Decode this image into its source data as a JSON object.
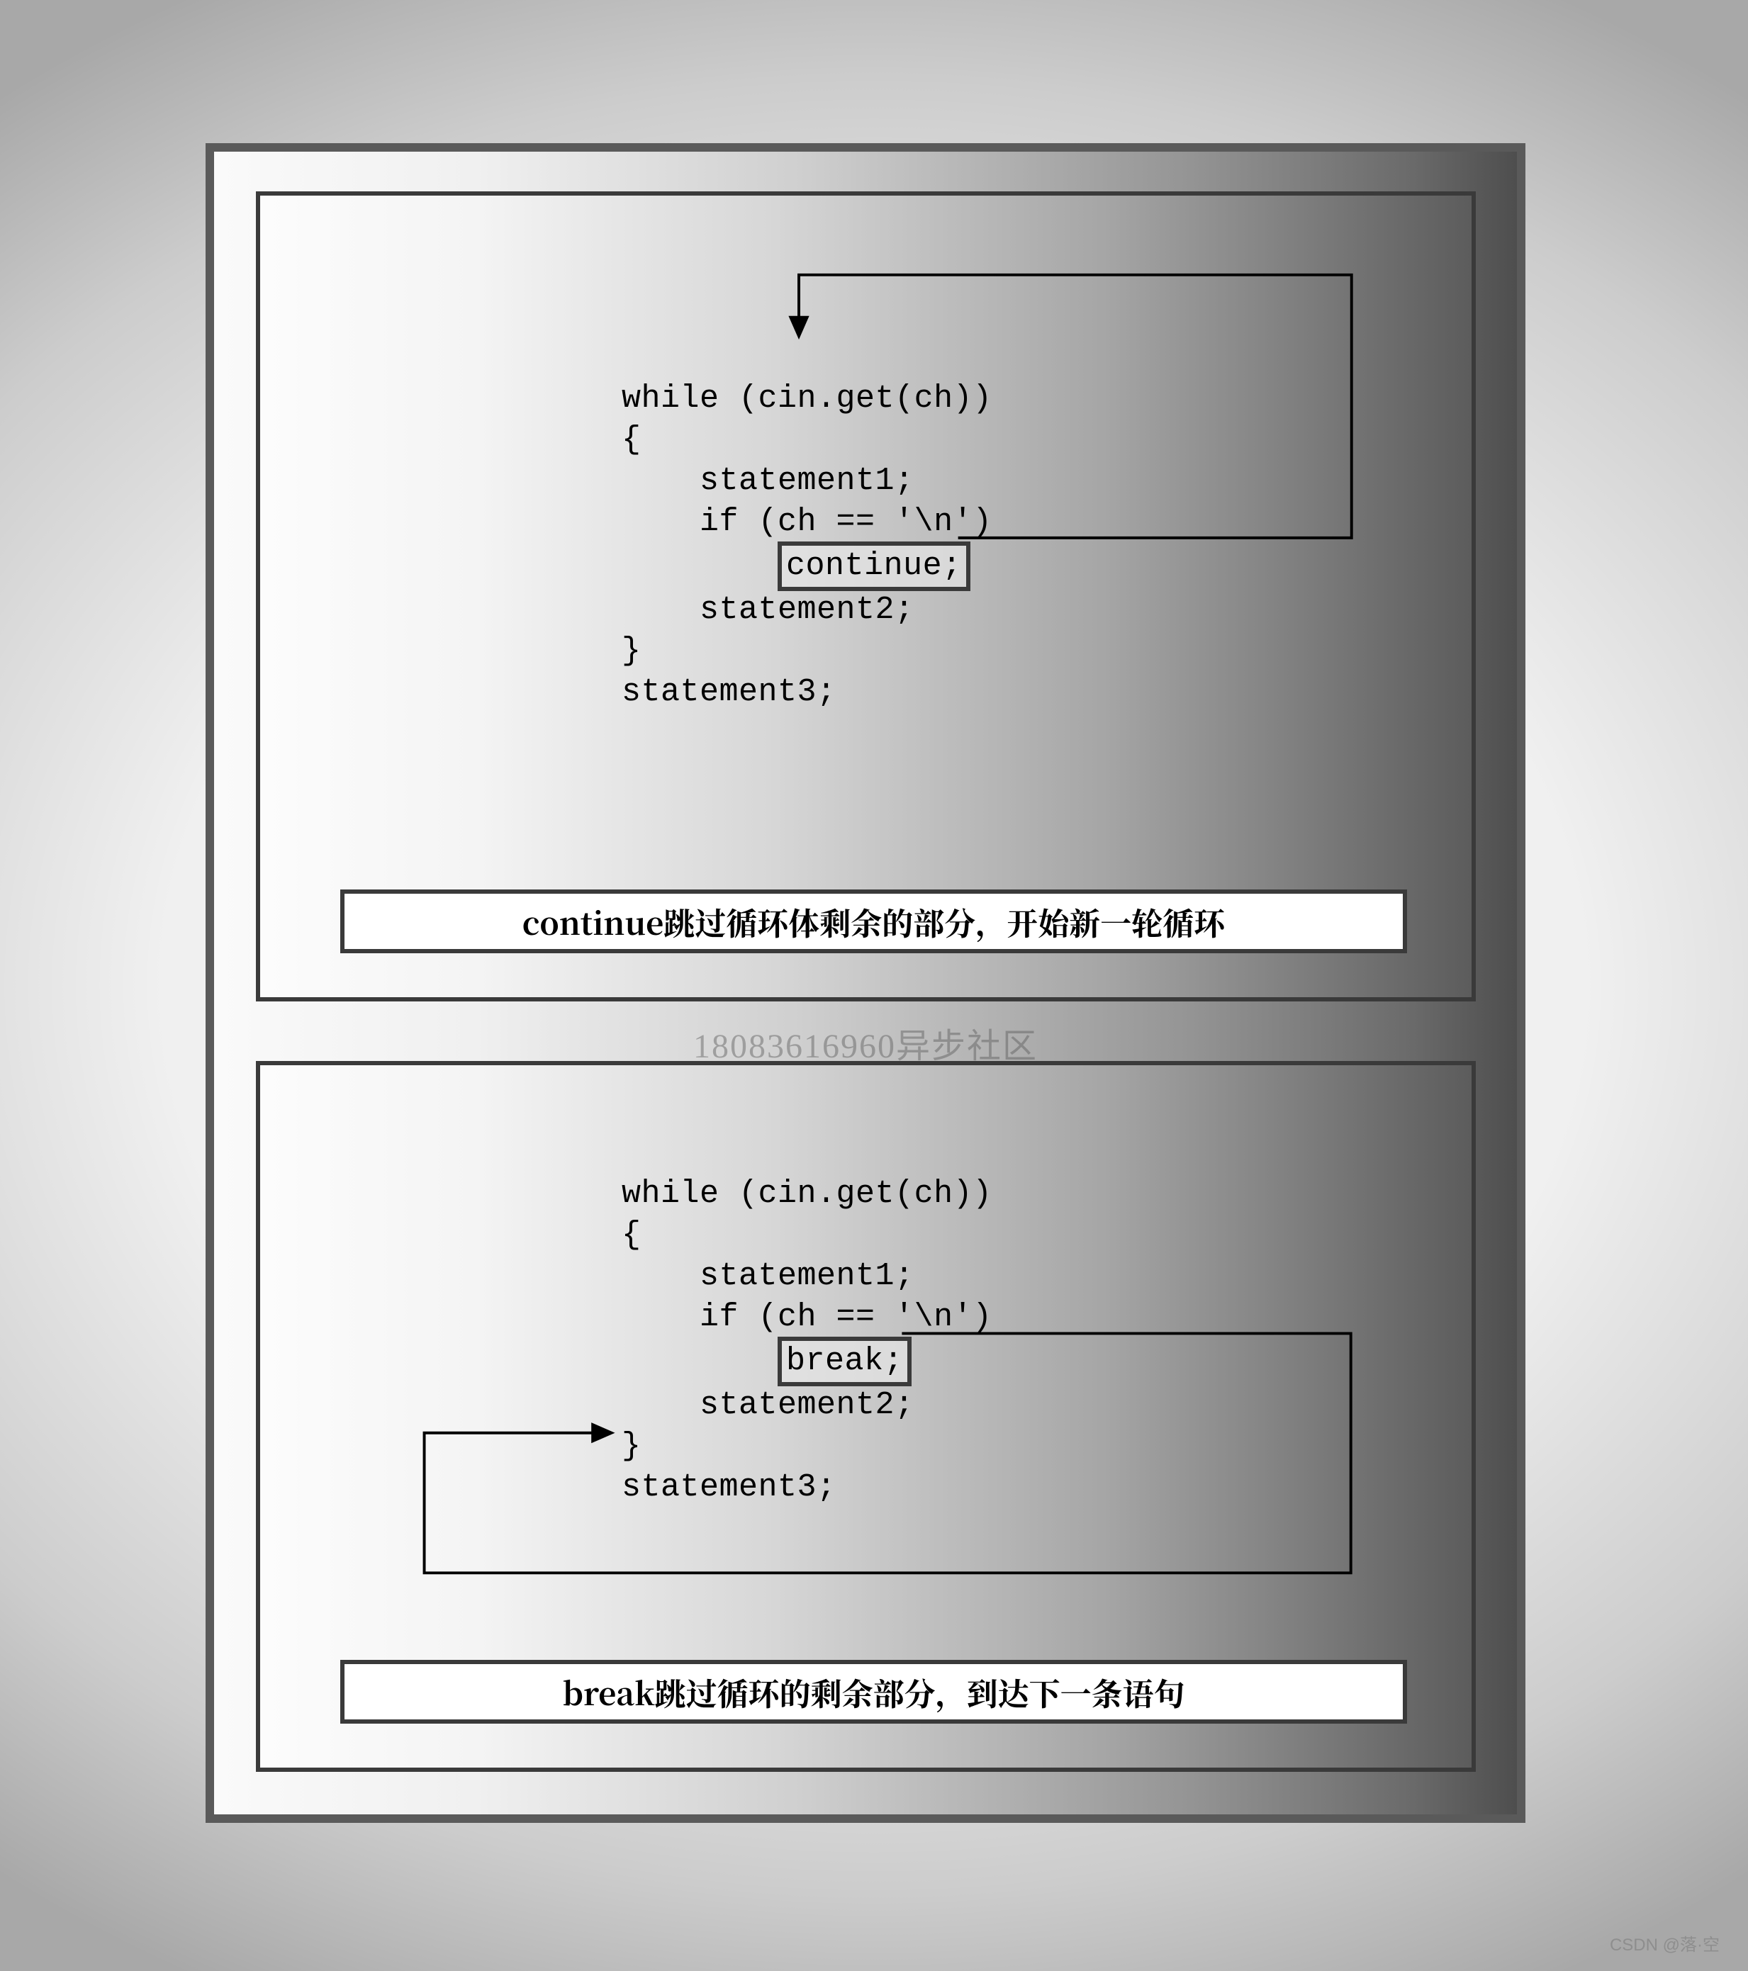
{
  "panels": {
    "continue": {
      "code": {
        "line1": "while (cin.get(ch))",
        "line2": "{",
        "line3": "    statement1;",
        "line4": "    if (ch == '\\n')",
        "hl": "continue;",
        "line5": "    statement2;",
        "line6": "}",
        "line7": "statement3;"
      },
      "caption": "continue跳过循环体剩余的部分，开始新一轮循环"
    },
    "break": {
      "code": {
        "line1": "while (cin.get(ch))",
        "line2": "{",
        "line3": "    statement1;",
        "line4": "    if (ch == '\\n')",
        "hl": "break;",
        "line5": "    statement2;",
        "line6": "}",
        "line7": "statement3;"
      },
      "caption": "break跳过循环的剩余部分，到达下一条语句"
    }
  },
  "watermarks": {
    "mid": "18083616960异步社区",
    "corner": "CSDN @落·空"
  }
}
